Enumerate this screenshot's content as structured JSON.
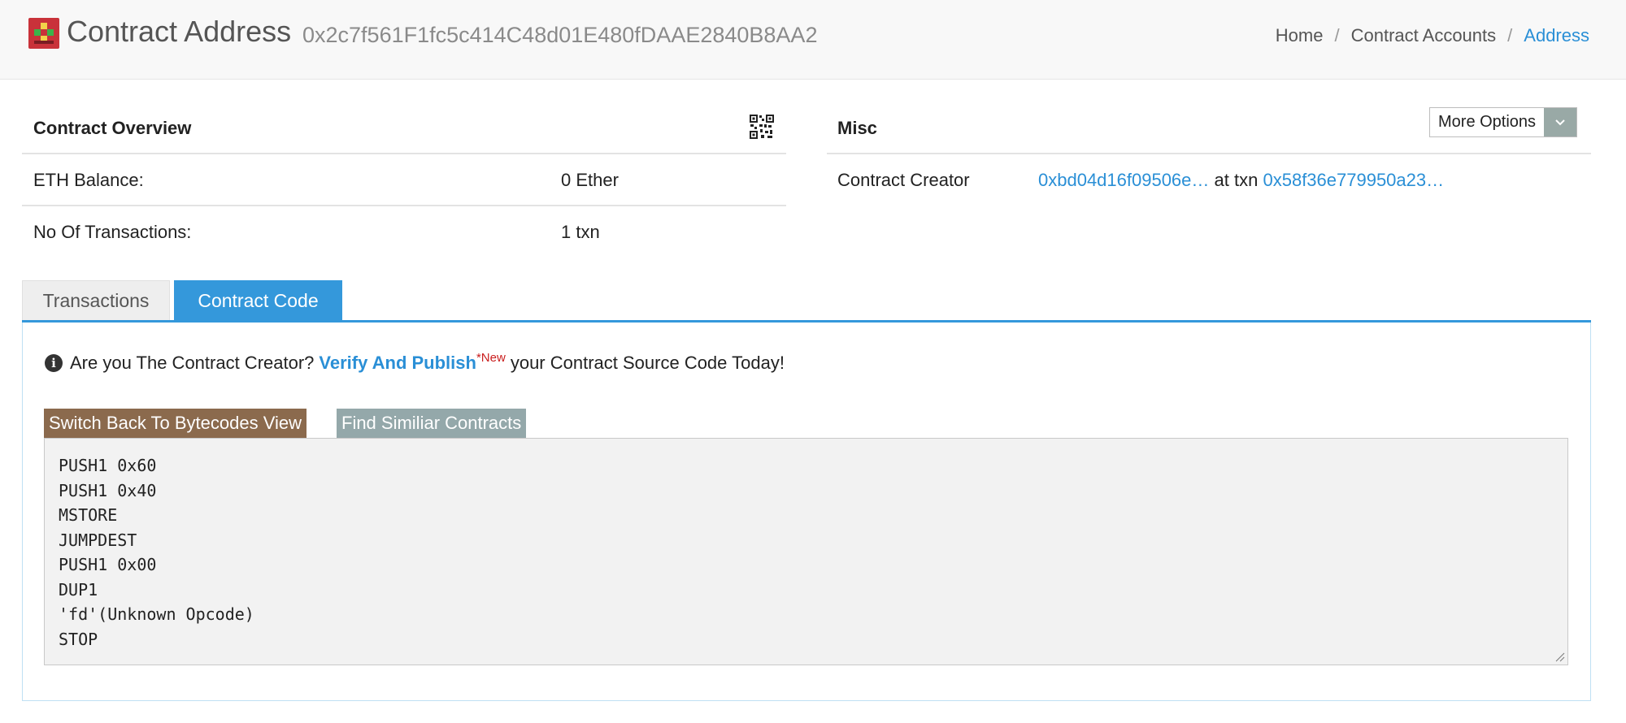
{
  "header": {
    "title": "Contract Address",
    "address": "0x2c7f561F1fc5c414C48d01E480fDAAE2840B8AA2",
    "breadcrumb": [
      {
        "label": "Home"
      },
      {
        "label": "Contract Accounts"
      },
      {
        "label": "Address"
      }
    ],
    "breadcrumb_separator": "/"
  },
  "overview": {
    "title": "Contract Overview",
    "qr_icon": "qr-code-icon",
    "balance_label": "ETH Balance:",
    "balance_value": "0 Ether",
    "txn_label": "No Of Transactions:",
    "txn_value": "1 txn"
  },
  "misc": {
    "title": "Misc",
    "more_options_label": "More Options",
    "creator_label": "Contract Creator",
    "creator_address": "0xbd04d16f09506e…",
    "at_txn_text": "at txn",
    "creator_txn": "0x58f36e779950a23…"
  },
  "tabs": [
    {
      "label": "Transactions",
      "active": false
    },
    {
      "label": "Contract Code",
      "active": true
    }
  ],
  "code_section": {
    "notice_prefix": "Are you The Contract Creator?",
    "verify_link": "Verify And Publish",
    "new_badge": "*New",
    "notice_suffix": "your Contract Source Code Today!",
    "switch_button": "Switch Back To Bytecodes View",
    "similar_button": "Find Similiar Contracts",
    "opcodes": [
      "PUSH1 0x60",
      "PUSH1 0x40",
      "MSTORE",
      "JUMPDEST",
      "PUSH1 0x00",
      "DUP1",
      "'fd'(Unknown Opcode)",
      "STOP"
    ]
  },
  "colors": {
    "accent": "#3498db",
    "link": "#2a8fd6",
    "switch_button": "#8b6a4d",
    "similar_button": "#94a8aa",
    "new_badge": "#c91d1d"
  }
}
